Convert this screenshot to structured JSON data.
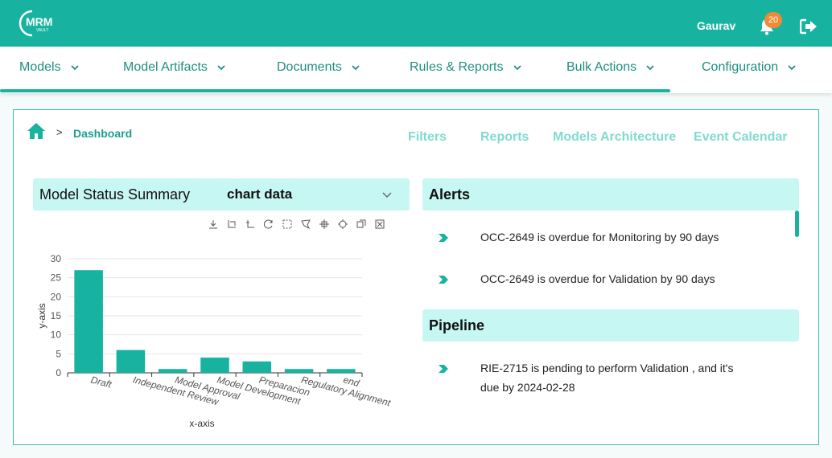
{
  "header": {
    "logo_text": "MRM",
    "logo_subtext": "VAULT",
    "user_name": "Gaurav",
    "notification_count": "20",
    "logout_icon": "logout-icon",
    "bell_icon": "bell-icon"
  },
  "nav": {
    "items": [
      {
        "label": "Models"
      },
      {
        "label": "Model Artifacts"
      },
      {
        "label": "Documents"
      },
      {
        "label": "Rules & Reports"
      },
      {
        "label": "Bulk Actions"
      },
      {
        "label": "Configuration"
      }
    ]
  },
  "breadcrumb": {
    "separator": ">",
    "current": "Dashboard"
  },
  "top_links": {
    "filters": "Filters",
    "reports": "Reports",
    "models_architecture": "Models Architecture",
    "event_calendar": "Event Calendar"
  },
  "summary": {
    "title": "Model Status Summary",
    "selected": "chart data"
  },
  "chart_data": {
    "type": "bar",
    "categories": [
      "Draft",
      "Independent Review",
      "Model Approval",
      "Model Development",
      "Preparacion",
      "Regulatory Alignment",
      "end"
    ],
    "values": [
      27,
      6,
      1,
      4,
      3,
      1,
      1
    ],
    "xlabel": "x-axis",
    "ylabel": "y-axis",
    "ylim": [
      0,
      30
    ],
    "yticks": [
      0,
      5,
      10,
      15,
      20,
      25,
      30
    ],
    "grid": true,
    "bar_color": "#17b3a0"
  },
  "alerts": {
    "title": "Alerts",
    "items": [
      {
        "text": "OCC-2649 is overdue for Monitoring by 90 days"
      },
      {
        "text": "OCC-2649 is overdue for Validation by 90 days"
      }
    ]
  },
  "pipeline": {
    "title": "Pipeline",
    "items": [
      {
        "line1": "RIE-2715 is pending to perform Validation , and it's",
        "line2": "due by 2024-02-28"
      }
    ]
  },
  "colors": {
    "brand": "#17b3a0",
    "accent_light": "#c7f7f3",
    "link_light": "#7fdbd0",
    "badge": "#f08a34"
  }
}
